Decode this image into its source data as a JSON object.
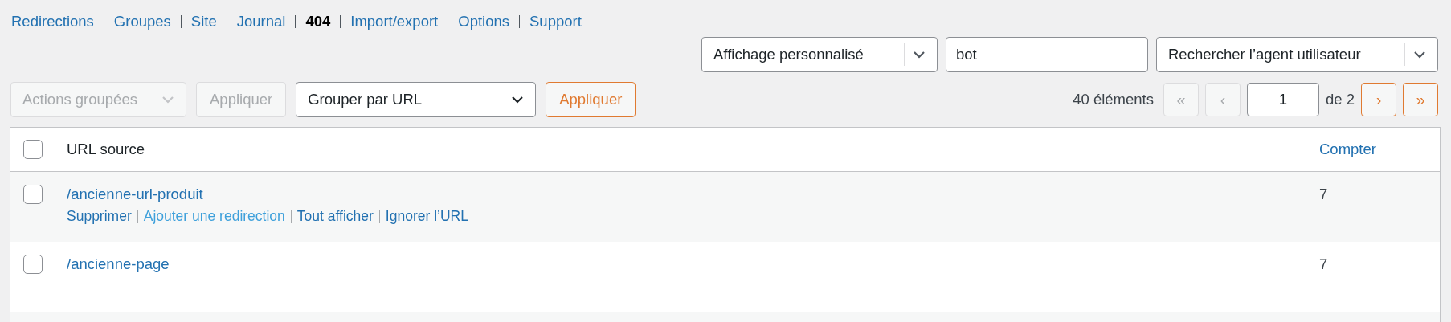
{
  "nav": [
    {
      "label": "Redirections",
      "current": false
    },
    {
      "label": "Groupes",
      "current": false
    },
    {
      "label": "Site",
      "current": false
    },
    {
      "label": "Journal",
      "current": false
    },
    {
      "label": "404",
      "current": true
    },
    {
      "label": "Import/export",
      "current": false
    },
    {
      "label": "Options",
      "current": false
    },
    {
      "label": "Support",
      "current": false
    }
  ],
  "filters": {
    "view_select": {
      "value": "Affichage personnalisé"
    },
    "search": {
      "value": "bot"
    },
    "search_type": {
      "value": "Rechercher l’agent utilisateur"
    }
  },
  "toolbar": {
    "bulk_actions": {
      "value": "Actions groupées",
      "disabled": true
    },
    "bulk_apply": {
      "label": "Appliquer",
      "disabled": true
    },
    "group_select": {
      "value": "Grouper par URL"
    },
    "group_apply": {
      "label": "Appliquer",
      "disabled": false
    }
  },
  "pagination": {
    "count": "40 éléments",
    "first": {
      "label": "«",
      "disabled": true
    },
    "prev": {
      "label": "‹",
      "disabled": true
    },
    "page": "1",
    "of": "de 2",
    "next": {
      "label": "›",
      "disabled": false
    },
    "last": {
      "label": "»",
      "disabled": false
    }
  },
  "table": {
    "select_all": {
      "checked": false
    },
    "columns": [
      {
        "label": "URL source",
        "sortable": false
      },
      {
        "label": "Compter",
        "sortable": true
      }
    ],
    "rows": [
      {
        "checked": false,
        "url": "/ancienne-url-produit",
        "count": "7",
        "actions": [
          {
            "label": "Supprimer",
            "hovered": false
          },
          {
            "label": "Ajouter une redirection",
            "hovered": true
          },
          {
            "label": "Tout afficher",
            "hovered": false
          },
          {
            "label": "Ignorer l’URL",
            "hovered": false
          }
        ]
      },
      {
        "checked": false,
        "url": "/ancienne-page",
        "count": "7",
        "actions": []
      }
    ]
  }
}
